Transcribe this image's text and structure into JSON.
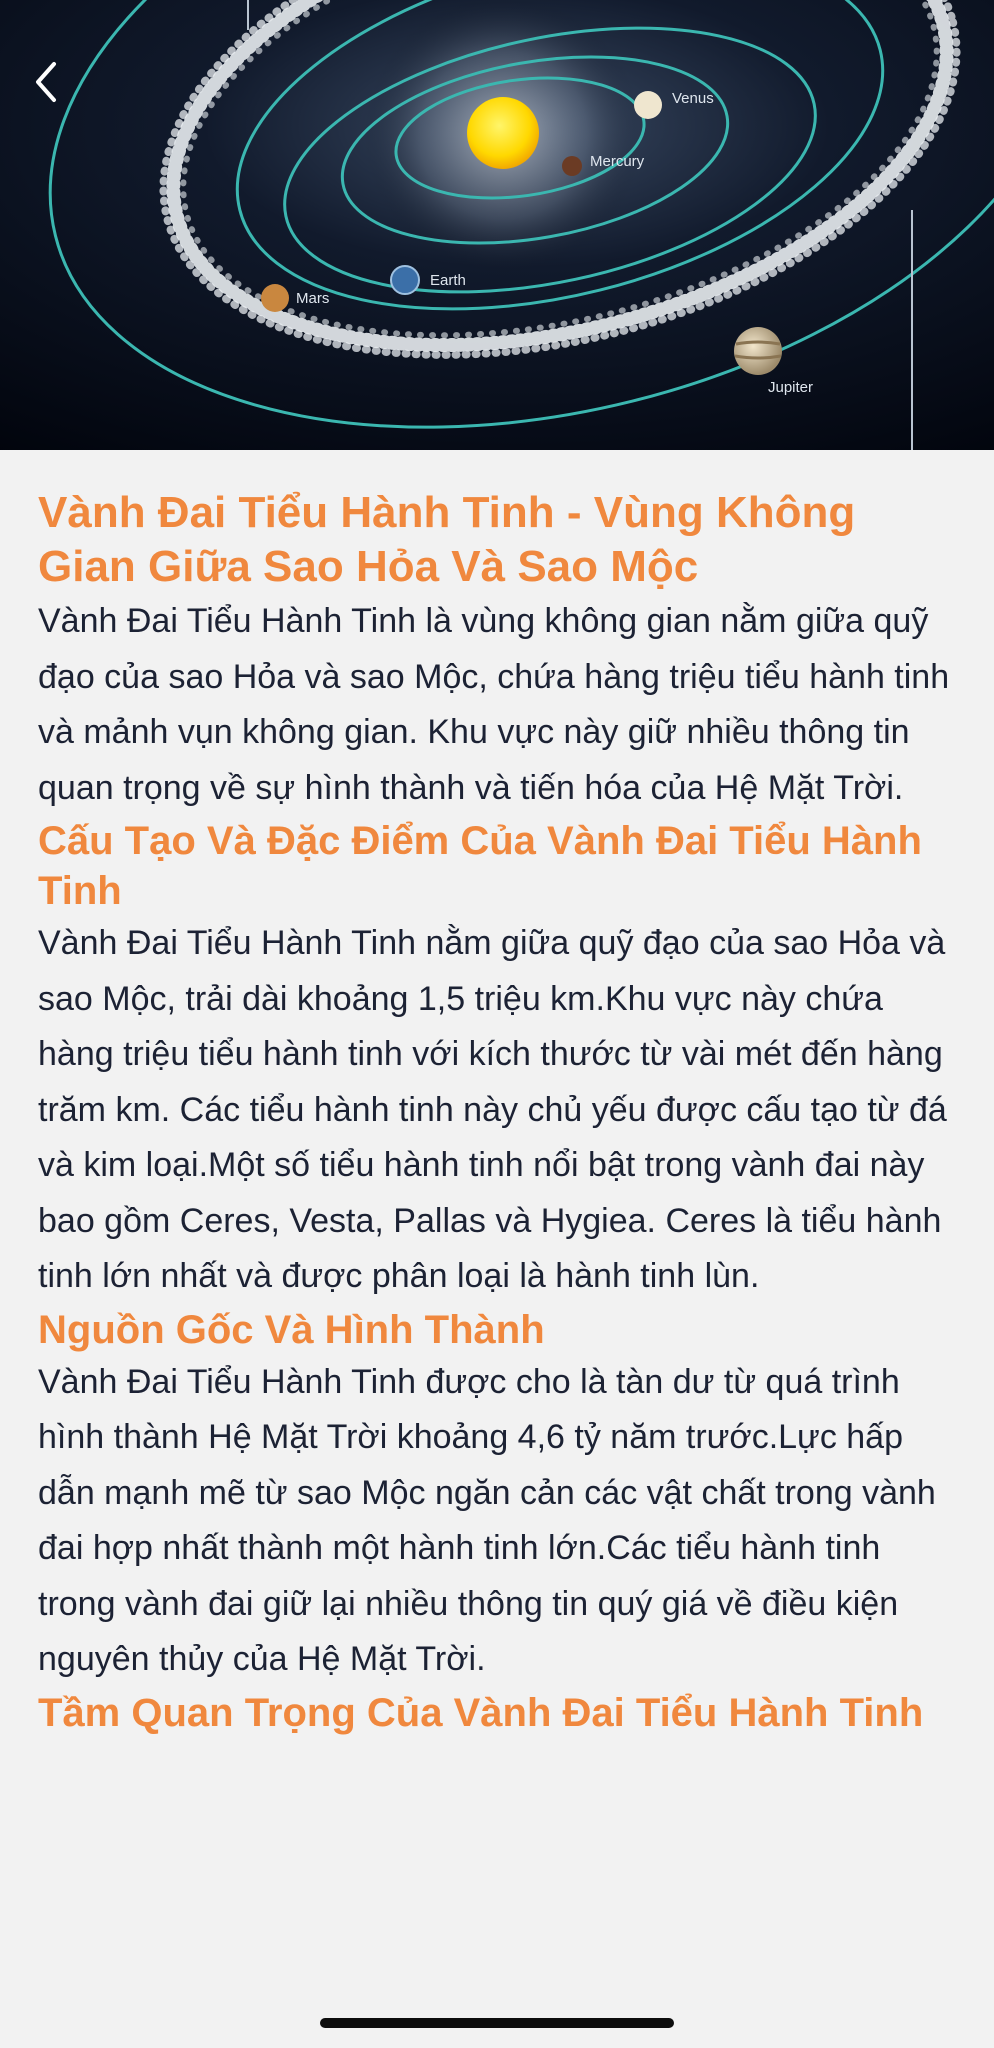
{
  "hero": {
    "labels": {
      "venus": "Venus",
      "mercury": "Mercury",
      "earth": "Earth",
      "mars": "Mars",
      "jupiter": "Jupiter"
    }
  },
  "article": {
    "title": "Vành Đai Tiểu Hành Tinh - Vùng Không Gian Giữa Sao Hỏa Và Sao Mộc",
    "intro": "Vành Đai Tiểu Hành Tinh là vùng không gian nằm giữa quỹ đạo của sao Hỏa và sao Mộc, chứa hàng triệu tiểu hành tinh và mảnh vụn không gian. Khu vực này giữ nhiều thông tin quan trọng về sự hình thành và tiến hóa của Hệ Mặt Trời.",
    "sections": [
      {
        "heading": "Cấu Tạo Và Đặc Điểm Của Vành Đai Tiểu Hành Tinh",
        "body": "Vành Đai Tiểu Hành Tinh nằm giữa quỹ đạo của sao Hỏa và sao Mộc, trải dài khoảng 1,5 triệu km.Khu vực này chứa hàng triệu tiểu hành tinh với kích thước từ vài mét đến hàng trăm km. Các tiểu hành tinh này chủ yếu được cấu tạo từ đá và kim loại.Một số tiểu hành tinh nổi bật trong vành đai này bao gồm Ceres, Vesta, Pallas và Hygiea. Ceres là tiểu hành tinh lớn nhất và được phân loại là hành tinh lùn."
      },
      {
        "heading": "Nguồn Gốc Và Hình Thành",
        "body": "Vành Đai Tiểu Hành Tinh được cho là tàn dư từ quá trình hình thành Hệ Mặt Trời khoảng 4,6 tỷ năm trước.Lực hấp dẫn mạnh mẽ từ sao Mộc ngăn cản các vật chất trong vành đai hợp nhất thành một hành tinh lớn.Các tiểu hành tinh trong vành đai giữ lại nhiều thông tin quý giá về điều kiện nguyên thủy của Hệ Mặt Trời."
      },
      {
        "heading": "Tầm Quan Trọng Của Vành Đai Tiểu Hành Tinh",
        "body": ""
      }
    ]
  },
  "colors": {
    "accent": "#f0883e",
    "text": "#1c2234",
    "background": "#f2f2f2"
  }
}
